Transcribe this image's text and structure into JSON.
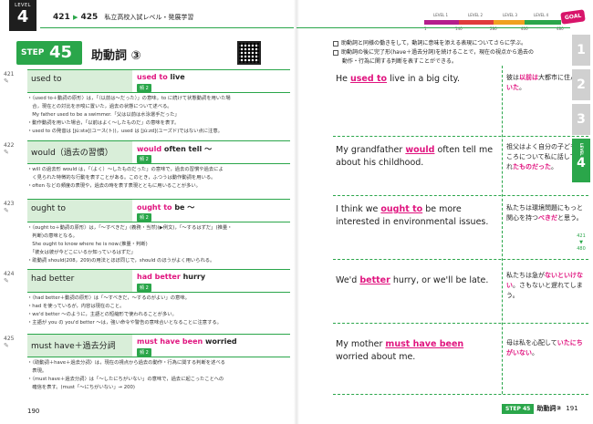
{
  "header": {
    "level_label": "LEVEL",
    "level_num": "4",
    "range_from": "421",
    "range_arrow": "▶",
    "range_to": "425",
    "range_sub": "私立高校入試レベル・発展学習"
  },
  "step": {
    "step_label": "STEP",
    "step_num": "45",
    "title": "助動詞 ③"
  },
  "items": [
    {
      "num": "421",
      "term": "used to",
      "phrase_pre": "",
      "phrase_mid": "used to",
      "phrase_post": " live",
      "key": "頻 2",
      "expl": [
        "・〈used to＋動詞の原形〉は，「（以前は～だった）」の意味。to に続けて状態動詞を用いた場",
        "　合，現在との対比を示唆に置いた，過去の状態について述べる。",
        "　My father used to be a swimmer.「父は以前は水泳選手だった」",
        "・動作動詞を用いた場合，「以前はよく～したものだ」の意味を表す。",
        "・used to の発音は [júːstə](ユース(ト))，used は [júːzd](ユーズド)ではない点に注意。"
      ]
    },
    {
      "num": "422",
      "term": "would（過去の習慣）",
      "phrase_pre": "",
      "phrase_mid": "would",
      "phrase_post": " often tell ～",
      "key": "頻 2",
      "expl": [
        "・will の過去形 would は，「（よく）～したものだった」の意味で，過去の習慣や過去によ",
        "　く見られた特徴的な行動を表すことがある。このとき，ふつうは動作動詞を用いる。",
        "・often などの頻度の表現や，過去の時を表す表現とともに用いることが多い。"
      ]
    },
    {
      "num": "423",
      "term": "ought to",
      "phrase_pre": "",
      "phrase_mid": "ought to",
      "phrase_post": " be ～",
      "key": "頻 2",
      "expl": [
        "・〈ought to＋動詞の原形〉は，「～すべきだ」(義務・当然)(▶例文)，「～するはずだ」(推量・",
        "　判断)の意味となる。",
        "　She ought to know where he is now.(推量・判断)",
        "　「彼女は彼が今どこにいるか知っているはずだ」",
        "・助動詞 should(208，209)の用法とほぼ同じで，should のほうがよく用いられる。"
      ]
    },
    {
      "num": "424",
      "term": "had better",
      "phrase_pre": "",
      "phrase_mid": "had better",
      "phrase_post": " hurry",
      "key": "頻 2",
      "expl": [
        "・〈had better＋動詞の原形〉は「～すべきだ，～するのがよい」の意味。",
        "・had を使っているが，内容は現在のこと。",
        "・we'd better ～のように，主語との短縮形で使われることが多い。",
        "・主語が you の you'd better ～は，強い命令や警告の意味合いとなることに注意する。"
      ]
    },
    {
      "num": "425",
      "term": "must have＋過去分詞",
      "phrase_pre": "",
      "phrase_mid": "must have been",
      "phrase_post": " worried",
      "key": "頻 2",
      "expl": [
        "・〈助動詞＋have＋過去分詞〉は，現在の視点から過去の動作・行為に関する判断を述べる",
        "　表現。",
        "・〈must have＋過去分詞〉は「～したにちがいない」の意味で，過去に起こったことへの",
        "　確信を表す。(must「～にちがいない」→ 200)"
      ]
    }
  ],
  "left_page_number": "190",
  "goal": {
    "levels": [
      "LEVEL 1",
      "LEVEL 2",
      "LEVEL 3",
      "LEVEL 4"
    ],
    "ticks": [
      "1",
      "140",
      "280",
      "400",
      "480"
    ],
    "goal_label": "GOAL",
    "colors": [
      "#b41e8c",
      "#e03c3c",
      "#f0a020",
      "#2aa64a"
    ]
  },
  "objectives": [
    "助動詞と同様の働きをして，動詞に意味を添える表現についてさらに学ぶ。",
    "助動詞の後に完了形(have＋過去分詞)を続けることで，現在の視点から過去の",
    "動作・行為に関する判断を表すことができる。"
  ],
  "objective_highlight": "完了形(have＋過去分詞)",
  "examples": [
    {
      "en_parts": [
        "He ",
        "used to",
        " live in a big city."
      ],
      "ja_parts": [
        "彼は",
        "以前は",
        "大都市に住んで",
        "いた",
        "。"
      ]
    },
    {
      "en_parts": [
        "My grandfather ",
        "would",
        " often tell me about his childhood."
      ],
      "ja_parts": [
        "祖父はよく自分の子どものころについて私に話してくれ",
        "たものだった",
        "。",
        "",
        ""
      ]
    },
    {
      "en_parts": [
        "I think we ",
        "ought to",
        " be more interested in environmental issues."
      ],
      "ja_parts": [
        "私たちは環境問題にもっと関心を持つ",
        "べきだ",
        "と思う。",
        "",
        ""
      ]
    },
    {
      "en_parts": [
        "We'd ",
        "better",
        " hurry, or we'll be late."
      ],
      "ja_parts": [
        "私たちは急が",
        "ないといけな",
        "い",
        "。さもないと遅れてしまう。",
        ""
      ]
    },
    {
      "en_parts": [
        "My mother ",
        "must have been",
        " worried about me."
      ],
      "ja_parts": [
        "母は私を心配して",
        "いたにちがいない",
        "。",
        "",
        ""
      ]
    }
  ],
  "side_tabs": [
    "1",
    "2",
    "3",
    "4"
  ],
  "side_active_label": "LEVEL",
  "side_range": [
    "421",
    "▼",
    "480"
  ],
  "footer": {
    "step": "STEP 45",
    "title": "助動詞③",
    "page": "191"
  }
}
